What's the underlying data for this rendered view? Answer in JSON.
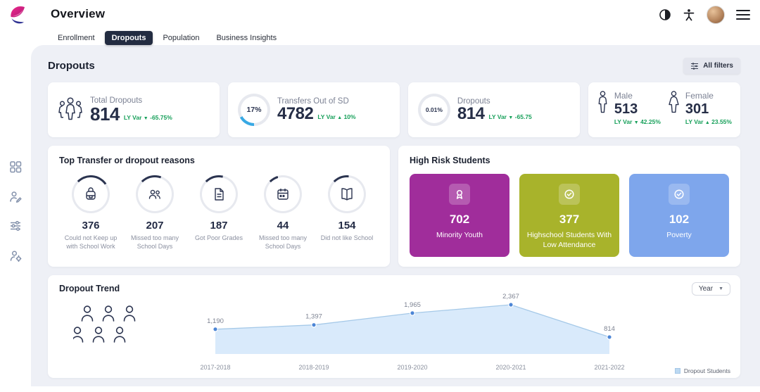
{
  "header": {
    "title": "Overview"
  },
  "tabs": [
    {
      "label": "Enrollment"
    },
    {
      "label": "Dropouts"
    },
    {
      "label": "Population"
    },
    {
      "label": "Business Insights"
    }
  ],
  "page": {
    "title": "Dropouts",
    "all_filters_label": "All filters"
  },
  "kpis": {
    "total": {
      "label": "Total Dropouts",
      "value": "814",
      "ly_var": "LY Var",
      "delta": "-65.75%",
      "direction": "down"
    },
    "transfers": {
      "label": "Transfers Out of SD",
      "pct": "17%",
      "pct_value": 17,
      "value": "4782",
      "ly_var": "LY Var",
      "delta": "10%",
      "direction": "up"
    },
    "dropouts": {
      "label": "Dropouts",
      "pct": "0.01%",
      "pct_value": 0.01,
      "value": "814",
      "ly_var": "LY Var",
      "delta": "-65.75",
      "direction": "down"
    },
    "male": {
      "label": "Male",
      "value": "513",
      "ly_var": "LY Var",
      "delta": "42.25%",
      "direction": "down"
    },
    "female": {
      "label": "Female",
      "value": "301",
      "ly_var": "LY Var",
      "delta": "23.55%",
      "direction": "up"
    }
  },
  "reasons": {
    "title": "Top Transfer or dropout reasons",
    "items": [
      {
        "value": "376",
        "label": "Could not Keep up with School Work",
        "icon": "schoolwork-icon",
        "arc_pct": 28
      },
      {
        "value": "207",
        "label": "Missed too many School Days",
        "icon": "attendance-icon",
        "arc_pct": 18
      },
      {
        "value": "187",
        "label": "Got Poor Grades",
        "icon": "grades-icon",
        "arc_pct": 16
      },
      {
        "value": "44",
        "label": "Missed too many School Days",
        "icon": "calendar-icon",
        "arc_pct": 8
      },
      {
        "value": "154",
        "label": "Did not like School",
        "icon": "school-icon",
        "arc_pct": 14
      }
    ]
  },
  "high_risk": {
    "title": "High Risk Students",
    "tiles": [
      {
        "value": "702",
        "label": "Minority Youth",
        "color": "#a02d9b",
        "icon": "award-icon"
      },
      {
        "value": "377",
        "label": "Highschool Students With Low Attendance",
        "color": "#a8b32b",
        "icon": "check-badge-icon"
      },
      {
        "value": "102",
        "label": "Poverty",
        "color": "#7ea6ec",
        "icon": "check-badge-icon"
      }
    ]
  },
  "trend": {
    "title": "Dropout Trend",
    "year_label": "Year",
    "legend_label": "Dropout Students"
  },
  "chart_data": {
    "type": "area",
    "title": "Dropout Trend",
    "categories": [
      "2017-2018",
      "2018-2019",
      "2019-2020",
      "2020-2021",
      "2021-2022"
    ],
    "values": [
      1190,
      1397,
      1965,
      2367,
      814
    ],
    "point_labels": [
      "1,190",
      "1,397",
      "1,965",
      "2,367",
      "814"
    ],
    "series_name": "Dropout Students",
    "legend_position": "bottom-right",
    "ylim": [
      0,
      2500
    ],
    "line_color": "#a5c9e8",
    "fill_color": "#d9eafb",
    "dot_color": "#4d86d6"
  },
  "colors": {
    "positive": "#17a05a",
    "accent_blue": "#38a9e4",
    "navy": "#2b3450",
    "background": "#eef0f6"
  }
}
